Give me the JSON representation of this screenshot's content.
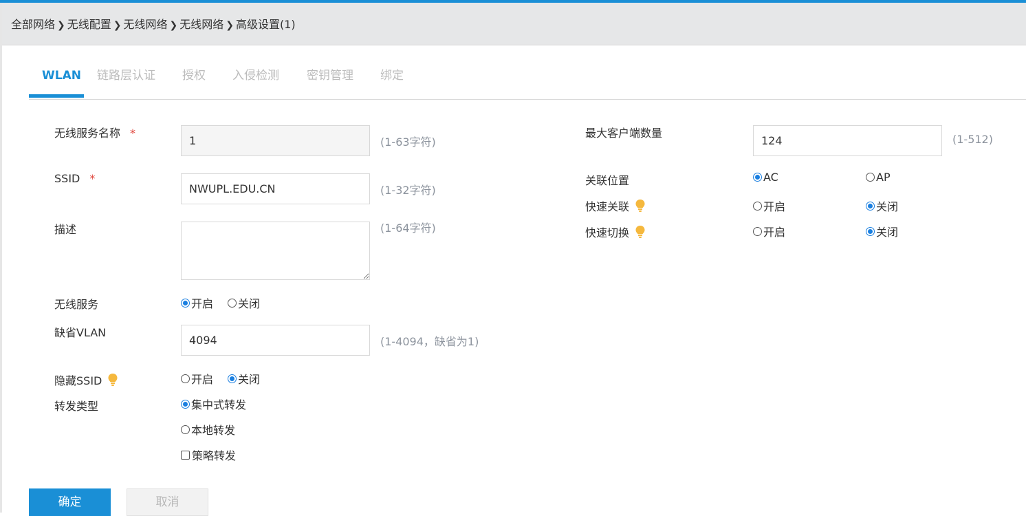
{
  "breadcrumb": [
    "全部网络",
    "无线配置",
    "无线网络",
    "无线网络",
    "高级设置(1)"
  ],
  "tabs": [
    "WLAN",
    "链路层认证",
    "授权",
    "入侵检测",
    "密钥管理",
    "绑定"
  ],
  "active_tab": "WLAN",
  "colors": {
    "accent": "#1a8fd6",
    "required": "#e0463c",
    "radio": "#1a7fe0",
    "bulb": "#f5b83d"
  },
  "form_left": {
    "service_name": {
      "label": "无线服务名称",
      "required_mark": "*",
      "value": "1",
      "hint": "(1-63字符)"
    },
    "ssid": {
      "label": "SSID",
      "required_mark": "*",
      "value": "NWUPL.EDU.CN",
      "hint": "(1-32字符)"
    },
    "description": {
      "label": "描述",
      "value": "",
      "hint": "(1-64字符)"
    },
    "wireless_service": {
      "label": "无线服务",
      "options": [
        "开启",
        "关闭"
      ],
      "selected": "开启"
    },
    "default_vlan": {
      "label": "缺省VLAN",
      "value": "4094",
      "hint": "(1-4094，缺省为1)"
    },
    "hide_ssid": {
      "label": "隐藏SSID",
      "options": [
        "开启",
        "关闭"
      ],
      "selected": "关闭"
    },
    "forward_type": {
      "label": "转发类型",
      "options": [
        "集中式转发",
        "本地转发"
      ],
      "selected": "集中式转发",
      "policy_checkbox": "策略转发",
      "policy_checked": false
    }
  },
  "form_right": {
    "max_clients": {
      "label": "最大客户端数量",
      "value": "124",
      "hint": "(1-512)"
    },
    "assoc_location": {
      "label": "关联位置",
      "options": [
        "AC",
        "AP"
      ],
      "selected": "AC"
    },
    "fast_assoc": {
      "label": "快速关联",
      "options": [
        "开启",
        "关闭"
      ],
      "selected": "关闭"
    },
    "fast_switch": {
      "label": "快速切换",
      "options": [
        "开启",
        "关闭"
      ],
      "selected": "关闭"
    }
  },
  "buttons": {
    "ok": "确定",
    "cancel": "取消"
  }
}
